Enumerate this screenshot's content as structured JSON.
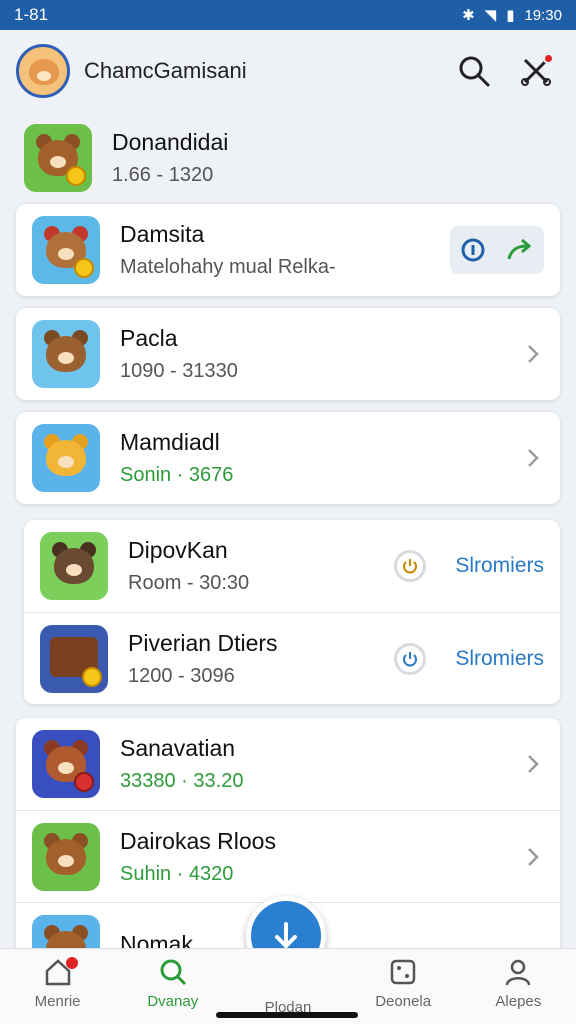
{
  "status": {
    "time_left": "1-81",
    "time_right": "19:30"
  },
  "header": {
    "title": "ChamcGamisani"
  },
  "items": [
    {
      "title": "Donandidai",
      "subtitle": "1.66 - 1320"
    },
    {
      "title": "Damsita",
      "subtitle": "Matelohahy mual  Relka-"
    },
    {
      "title": "Pacla",
      "subtitle": "1090 - 31330"
    },
    {
      "title": "Mamdiadl",
      "subtitle": "Sonin · 3676"
    },
    {
      "title": "DipovKan",
      "subtitle": "Room - 30:30",
      "action": "Slromiers"
    },
    {
      "title": "Piverian Dtiers",
      "subtitle": "1200 - 3096",
      "action": "Slromiers"
    },
    {
      "title": "Sanavatian",
      "subtitle": "33380 · 33.20"
    },
    {
      "title": "Dairokas Rloos",
      "subtitle": "Suhin · 4320"
    },
    {
      "title": "Nomak",
      "subtitle": ""
    }
  ],
  "nav": [
    {
      "label": "Menrie"
    },
    {
      "label": "Dvanay"
    },
    {
      "label": "Plodan"
    },
    {
      "label": "Deonela"
    },
    {
      "label": "Alepes"
    }
  ],
  "colors": {
    "accent": "#1f5fa8",
    "green": "#2c9b3a",
    "link": "#2979c6"
  }
}
